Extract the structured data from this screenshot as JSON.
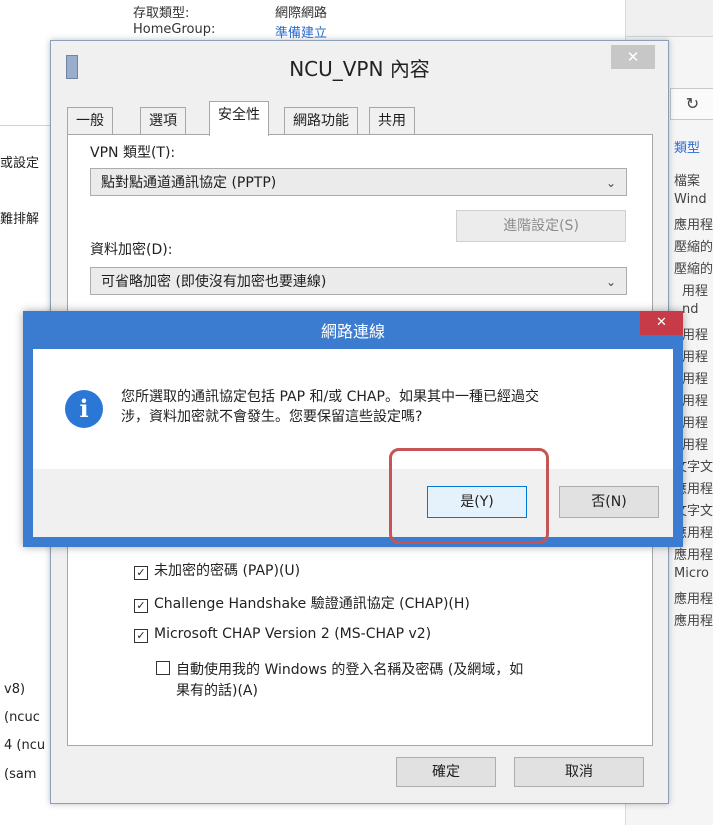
{
  "background_window": {
    "top_label_1": "存取類型:",
    "top_value_1": "網際網路",
    "top_label_2": "HomeGroup:",
    "top_value_2": "準備建立",
    "left_labels": [
      "或設定",
      "難排解"
    ],
    "left_bottom": [
      "v8)",
      "(ncuc",
      "4 (ncu",
      "(sam"
    ]
  },
  "right_panel": {
    "refresh_icon": "refresh-icon",
    "header": "類型",
    "items": [
      "檔案",
      "Wind",
      "應用程",
      "壓縮的",
      "壓縮的",
      "用程",
      "nd",
      "用程",
      "用程",
      "用程",
      "用程",
      "用程",
      "用程",
      "文字文",
      "應用程",
      "文字文",
      "應用程",
      "應用程",
      "Micro",
      "應用程",
      "應用程"
    ]
  },
  "vpn_dialog": {
    "title": "NCU_VPN 內容",
    "close_glyph": "✕",
    "tabs": [
      "一般",
      "選項",
      "安全性",
      "網路功能",
      "共用"
    ],
    "active_tab": "安全性",
    "vpn_type_label": "VPN 類型(T):",
    "vpn_type_value": "點對點通道通訊協定 (PPTP)",
    "advanced_button": "進階設定(S)",
    "encryption_label": "資料加密(D):",
    "encryption_value": "可省略加密 (即使沒有加密也要連線)",
    "checkboxes": [
      {
        "label": "未加密的密碼 (PAP)(U)",
        "checked": true
      },
      {
        "label": "Challenge Handshake 驗證通訊協定 (CHAP)(H)",
        "checked": true
      },
      {
        "label": "Microsoft CHAP Version 2 (MS-CHAP v2)",
        "checked": true
      }
    ],
    "sub_checkbox_line1": "自動使用我的 Windows 的登入名稱及密碼 (及網域，如",
    "sub_checkbox_line2": "果有的話)(A)",
    "ok_button": "確定",
    "cancel_button": "取消"
  },
  "message_box": {
    "title": "網路連線",
    "close_glyph": "✕",
    "icon": "info-icon",
    "icon_glyph": "i",
    "text_line1": "您所選取的通訊協定包括 PAP 和/或 CHAP。如果其中一種已經過交",
    "text_line2": "涉，資料加密就不會發生。您要保留這些設定嗎?",
    "yes_button": "是(Y)",
    "no_button": "否(N)"
  },
  "colors": {
    "message_title_bar": "#3c7cd0",
    "message_close": "#c73b48",
    "highlight": "#c75454"
  }
}
